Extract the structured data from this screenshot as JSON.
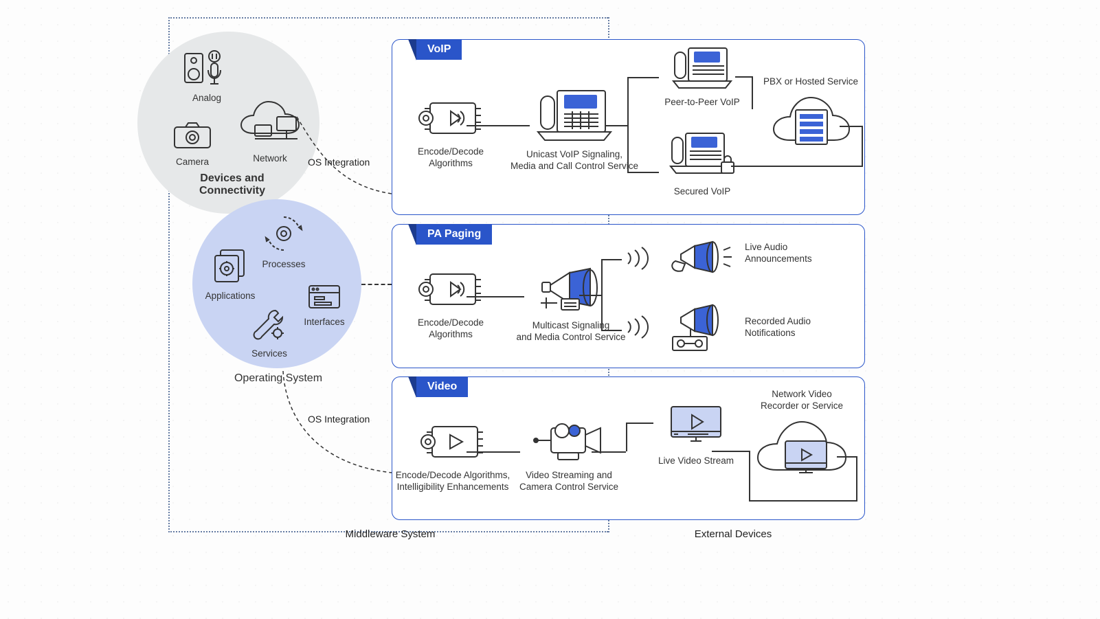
{
  "sections": {
    "middleware": "Middleware System",
    "external": "External Devices"
  },
  "os_integration_top": "OS Integration",
  "os_integration_bottom": "OS Integration",
  "circle_devices": {
    "title": "Devices and\nConnectivity",
    "analog": "Analog",
    "camera": "Camera",
    "network": "Network"
  },
  "circle_os": {
    "title": "Operating System",
    "processes": "Processes",
    "applications": "Applications",
    "interfaces": "Interfaces",
    "services": "Services"
  },
  "panels": {
    "voip": {
      "badge": "VoIP",
      "encode": "Encode/Decode\nAlgorithms",
      "signaling": "Unicast VoIP Signaling,\nMedia and Call Control Service",
      "peer": "Peer-to-Peer VoIP",
      "secured": "Secured VoIP",
      "pbx": "PBX or Hosted Service"
    },
    "pa": {
      "badge": "PA Paging",
      "encode": "Encode/Decode\nAlgorithms",
      "signaling": "Multicast Signaling\nand Media Control Service",
      "live": "Live Audio\nAnnouncements",
      "recorded": "Recorded Audio\nNotifications"
    },
    "video": {
      "badge": "Video",
      "encode": "Encode/Decode Algorithms,\nIntelligibility Enhancements",
      "stream_svc": "Video Streaming and\nCamera Control Service",
      "live": "Live Video Stream",
      "nvr": "Network Video\nRecorder or Service"
    }
  }
}
